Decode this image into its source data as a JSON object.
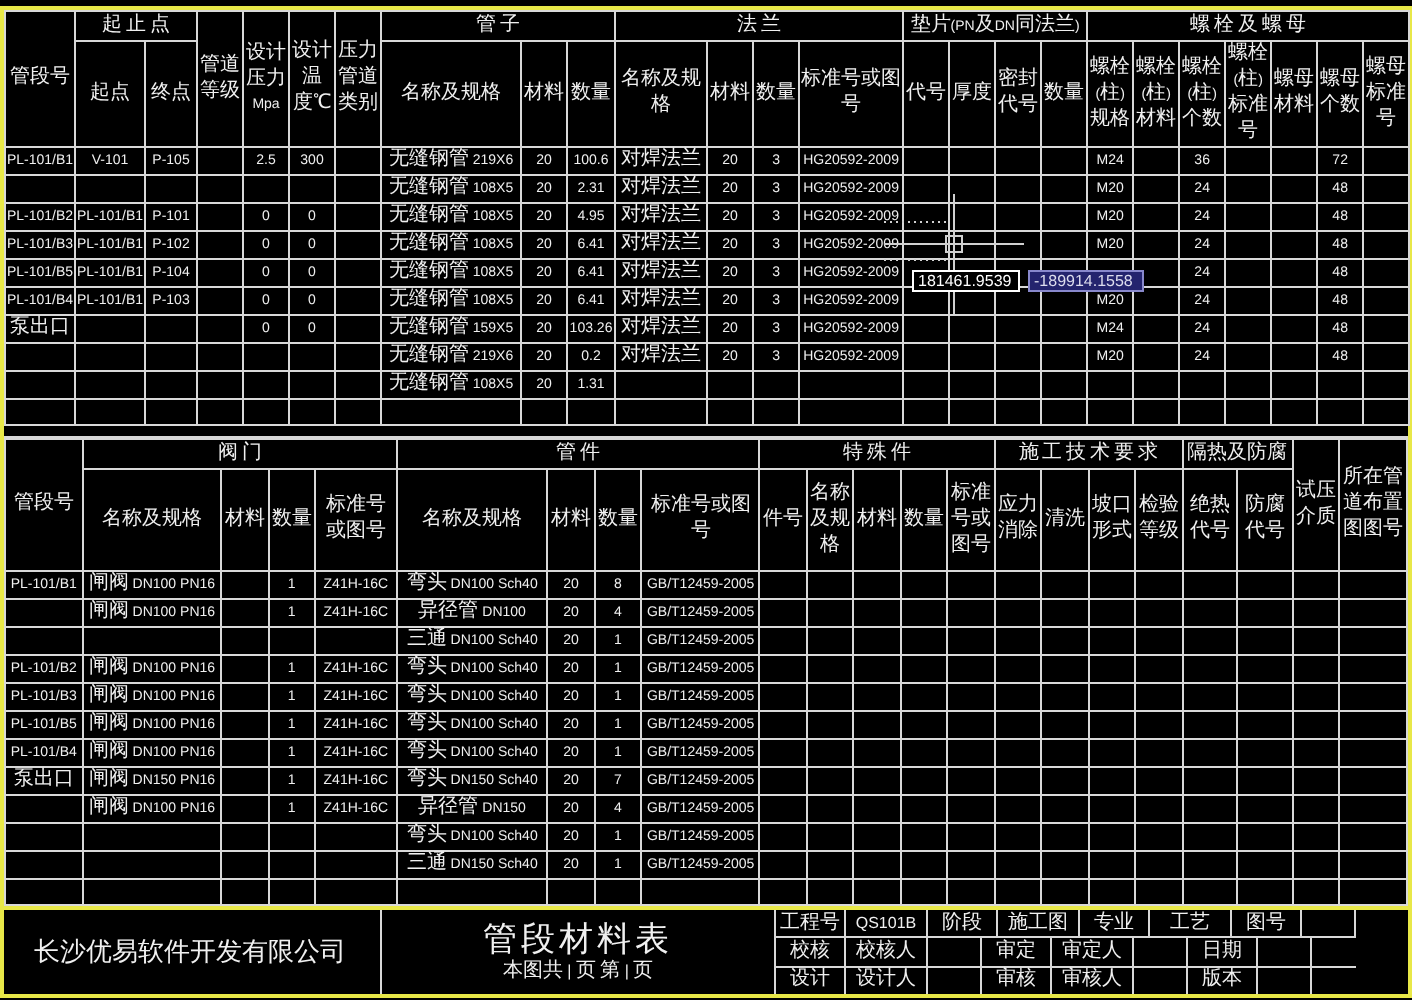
{
  "top_table": {
    "header": [
      {
        "label": "管段号"
      },
      {
        "label": "起 止 点",
        "columns": [
          "起点",
          "终点"
        ]
      },
      {
        "label": "管道等级"
      },
      {
        "label": "设计压力Mpa"
      },
      {
        "label": "设计温度℃"
      },
      {
        "label": "压力管道类别"
      },
      {
        "label": "管 子",
        "columns": [
          "名称及规格",
          "材料",
          "数量"
        ]
      },
      {
        "label": "法 兰",
        "columns": [
          "名称及规格",
          "材料",
          "数量",
          "标准号或图号"
        ]
      },
      {
        "label": "垫片(PN及DN同法兰)",
        "columns": [
          "代号",
          "厚度",
          "密封代号",
          "数量"
        ]
      },
      {
        "label": "螺 栓 及 螺 母",
        "columns": [
          "螺栓(柱)规格",
          "螺栓(柱)材料",
          "螺栓(柱)个数",
          "螺栓(柱)标准号",
          "螺母材料",
          "螺母个数",
          "螺母标准号"
        ]
      }
    ],
    "rows": [
      [
        "PL-101/B1",
        "V-101",
        "P-105",
        null,
        "2.5",
        "300",
        null,
        "无缝钢管 219X6",
        "20",
        "100.6",
        "对焊法兰",
        "20",
        "3",
        "HG20592-2009",
        null,
        null,
        null,
        null,
        "M24",
        null,
        "36",
        null,
        null,
        "72",
        null
      ],
      [
        null,
        null,
        null,
        null,
        null,
        null,
        null,
        "无缝钢管 108X5",
        "20",
        "2.31",
        "对焊法兰",
        "20",
        "3",
        "HG20592-2009",
        null,
        null,
        null,
        null,
        "M20",
        null,
        "24",
        null,
        null,
        "48",
        null
      ],
      [
        "PL-101/B2",
        "PL-101/B1",
        "P-101",
        null,
        "0",
        "0",
        null,
        "无缝钢管 108X5",
        "20",
        "4.95",
        "对焊法兰",
        "20",
        "3",
        "HG20592-2009",
        null,
        null,
        null,
        null,
        "M20",
        null,
        "24",
        null,
        null,
        "48",
        null
      ],
      [
        "PL-101/B3",
        "PL-101/B1",
        "P-102",
        null,
        "0",
        "0",
        null,
        "无缝钢管 108X5",
        "20",
        "6.41",
        "对焊法兰",
        "20",
        "3",
        "HG20592-2009",
        null,
        null,
        null,
        null,
        "M20",
        null,
        "24",
        null,
        null,
        "48",
        null
      ],
      [
        "PL-101/B5",
        "PL-101/B1",
        "P-104",
        null,
        "0",
        "0",
        null,
        "无缝钢管 108X5",
        "20",
        "6.41",
        "对焊法兰",
        "20",
        "3",
        "HG20592-2009",
        null,
        null,
        null,
        null,
        null,
        null,
        "24",
        null,
        null,
        "48",
        null
      ],
      [
        "PL-101/B4",
        "PL-101/B1",
        "P-103",
        null,
        "0",
        "0",
        null,
        "无缝钢管 108X5",
        "20",
        "6.41",
        "对焊法兰",
        "20",
        "3",
        "HG20592-2009",
        null,
        null,
        null,
        null,
        "M20",
        null,
        "24",
        null,
        null,
        "48",
        null
      ],
      [
        "泵出口",
        null,
        null,
        null,
        "0",
        "0",
        null,
        "无缝钢管 159X5",
        "20",
        "103.26",
        "对焊法兰",
        "20",
        "3",
        "HG20592-2009",
        null,
        null,
        null,
        null,
        "M24",
        null,
        "24",
        null,
        null,
        "48",
        null
      ],
      [
        null,
        null,
        null,
        null,
        null,
        null,
        null,
        "无缝钢管 219X6",
        "20",
        "0.2",
        "对焊法兰",
        "20",
        "3",
        "HG20592-2009",
        null,
        null,
        null,
        null,
        "M20",
        null,
        "24",
        null,
        null,
        "48",
        null
      ],
      [
        null,
        null,
        null,
        null,
        null,
        null,
        null,
        "无缝钢管 108X5",
        "20",
        "1.31",
        null,
        null,
        null,
        null,
        null,
        null,
        null,
        null,
        null,
        null,
        null,
        null,
        null,
        null,
        null
      ]
    ]
  },
  "bottom_table": {
    "header": [
      {
        "label": "管段号"
      },
      {
        "label": "阀 门",
        "columns": [
          "名称及规格",
          "材料",
          "数量",
          "标准号或图号"
        ]
      },
      {
        "label": "管 件",
        "columns": [
          "名称及规格",
          "材料",
          "数量",
          "标准号或图号"
        ]
      },
      {
        "label": "特 殊 件",
        "columns": [
          "件号",
          "名称及规格",
          "材料",
          "数量",
          "标准号或图号"
        ]
      },
      {
        "label": "施 工 技 术 要 求",
        "columns": [
          "应力消除",
          "清洗",
          "坡口形式",
          "检验等级"
        ]
      },
      {
        "label": "隔热及防腐",
        "columns": [
          "绝热代号",
          "防腐代号"
        ]
      },
      {
        "label": "试压介质"
      },
      {
        "label": "所在管道布置图图号"
      }
    ],
    "rows": [
      [
        "PL-101/B1",
        "闸阀 DN100 PN16",
        null,
        "1",
        "Z41H-16C",
        "弯头 DN100 Sch40",
        "20",
        "8",
        "GB/T12459-2005"
      ],
      [
        null,
        "闸阀 DN100 PN16",
        null,
        "1",
        "Z41H-16C",
        "异径管 DN100",
        "20",
        "4",
        "GB/T12459-2005"
      ],
      [
        null,
        null,
        null,
        null,
        null,
        "三通 DN100 Sch40",
        "20",
        "1",
        "GB/T12459-2005"
      ],
      [
        "PL-101/B2",
        "闸阀 DN100 PN16",
        null,
        "1",
        "Z41H-16C",
        "弯头 DN100 Sch40",
        "20",
        "1",
        "GB/T12459-2005"
      ],
      [
        "PL-101/B3",
        "闸阀 DN100 PN16",
        null,
        "1",
        "Z41H-16C",
        "弯头 DN100 Sch40",
        "20",
        "1",
        "GB/T12459-2005"
      ],
      [
        "PL-101/B5",
        "闸阀 DN100 PN16",
        null,
        "1",
        "Z41H-16C",
        "弯头 DN100 Sch40",
        "20",
        "1",
        "GB/T12459-2005"
      ],
      [
        "PL-101/B4",
        "闸阀 DN100 PN16",
        null,
        "1",
        "Z41H-16C",
        "弯头 DN100 Sch40",
        "20",
        "1",
        "GB/T12459-2005"
      ],
      [
        "泵出口",
        "闸阀 DN150 PN16",
        null,
        "1",
        "Z41H-16C",
        "弯头 DN150 Sch40",
        "20",
        "7",
        "GB/T12459-2005"
      ],
      [
        null,
        "闸阀 DN100 PN16",
        null,
        "1",
        "Z41H-16C",
        "异径管 DN150",
        "20",
        "4",
        "GB/T12459-2005"
      ],
      [
        null,
        null,
        null,
        null,
        null,
        "弯头 DN100 Sch40",
        "20",
        "1",
        "GB/T12459-2005"
      ],
      [
        null,
        null,
        null,
        null,
        null,
        "三通 DN150 Sch40",
        "20",
        "1",
        "GB/T12459-2005"
      ]
    ]
  },
  "title_block": {
    "company": "长沙优易软件开发有限公司",
    "title": "管段材料表",
    "sheet": "本图共 | 页 第 | 页",
    "rows": [
      [
        {
          "kind": "label",
          "text": "工程号"
        },
        {
          "kind": "value",
          "text": "QS101B"
        },
        {
          "kind": "label",
          "text": "阶段"
        },
        {
          "kind": "value",
          "text": "施工图"
        },
        {
          "kind": "label",
          "text": "专业"
        },
        {
          "kind": "value",
          "text": "工艺"
        },
        {
          "kind": "label",
          "text": "图号"
        },
        {
          "kind": "blank"
        }
      ],
      [
        {
          "kind": "label",
          "text": "校核"
        },
        {
          "kind": "value",
          "text": "校核人"
        },
        {
          "kind": "blank"
        },
        {
          "kind": "label",
          "text": "审定"
        },
        {
          "kind": "value",
          "text": "审定人"
        },
        {
          "kind": "blank"
        },
        {
          "kind": "label",
          "text": "日期"
        },
        {
          "kind": "blank"
        }
      ],
      [
        {
          "kind": "label",
          "text": "设计"
        },
        {
          "kind": "value",
          "text": "设计人"
        },
        {
          "kind": "blank"
        },
        {
          "kind": "label",
          "text": "审核"
        },
        {
          "kind": "value",
          "text": "审核人"
        },
        {
          "kind": "blank"
        },
        {
          "kind": "label",
          "text": "版本"
        },
        {
          "kind": "blank"
        }
      ]
    ]
  },
  "cursor": {
    "x_readout": "181461.9539",
    "y_readout": "-189914.1558"
  }
}
